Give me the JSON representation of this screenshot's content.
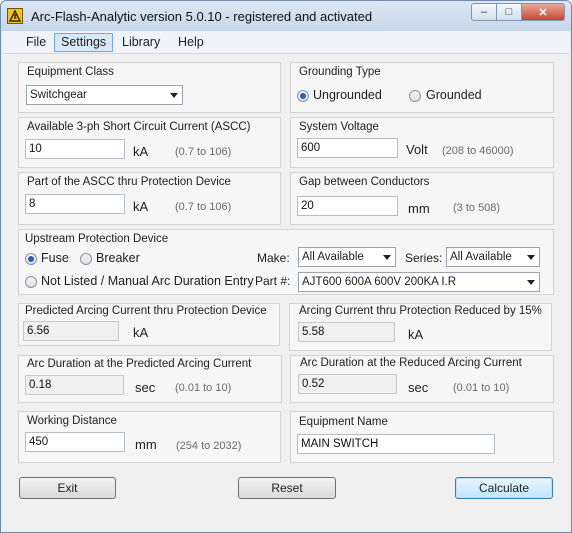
{
  "window": {
    "title": "Arc-Flash-Analytic version 5.0.10 - registered and activated",
    "controls": {
      "minimize": "–",
      "maximize": "□",
      "close": "✕"
    }
  },
  "menu": [
    "File",
    "Settings",
    "Library",
    "Help"
  ],
  "equipment_class": {
    "label": "Equipment Class",
    "value": "Switchgear"
  },
  "grounding": {
    "label": "Grounding Type",
    "options": [
      "Ungrounded",
      "Grounded"
    ],
    "selected": "Ungrounded"
  },
  "ascc": {
    "label": "Available 3-ph Short Circuit Current (ASCC)",
    "value": "10",
    "unit": "kA",
    "range": "(0.7 to 106)"
  },
  "voltage": {
    "label": "System Voltage",
    "value": "600",
    "unit": "Volt",
    "range": "(208 to 46000)"
  },
  "ascc_part": {
    "label": "Part of the ASCC thru Protection Device",
    "value": "8",
    "unit": "kA",
    "range": "(0.7 to 106)"
  },
  "gap": {
    "label": "Gap between Conductors",
    "value": "20",
    "unit": "mm",
    "range": "(3 to 508)"
  },
  "upstream": {
    "label": "Upstream Protection Device",
    "options": [
      "Fuse",
      "Breaker",
      "Not Listed / Manual Arc Duration Entry"
    ],
    "selected": "Fuse",
    "make_label": "Make:",
    "make_value": "All Available",
    "series_label": "Series:",
    "series_value": "All Available",
    "part_label": "Part #:",
    "part_value": "AJT600 600A 600V 200KA I.R"
  },
  "arcing_current": {
    "label": "Predicted Arcing Current thru Protection Device",
    "value": "6.56",
    "unit": "kA"
  },
  "arcing_reduced": {
    "label": "Arcing Current thru Protection Reduced by 15%",
    "value": "5.58",
    "unit": "kA"
  },
  "arc_duration": {
    "label": "Arc Duration at the Predicted Arcing Current",
    "value": "0.18",
    "unit": "sec",
    "range": "(0.01 to 10)"
  },
  "arc_duration_reduced": {
    "label": "Arc Duration at the Reduced Arcing Current",
    "value": "0.52",
    "unit": "sec",
    "range": "(0.01 to 10)"
  },
  "working_distance": {
    "label": "Working Distance",
    "value": "450",
    "unit": "mm",
    "range": "(254 to 2032)"
  },
  "equipment_name": {
    "label": "Equipment Name",
    "value": "MAIN SWITCH"
  },
  "buttons": {
    "exit": "Exit",
    "reset": "Reset",
    "calculate": "Calculate"
  }
}
